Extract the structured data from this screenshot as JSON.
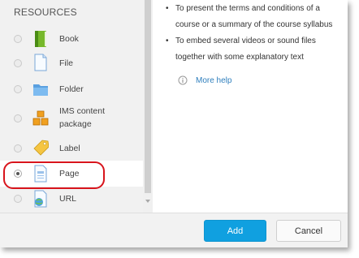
{
  "resources": {
    "title": "RESOURCES",
    "items": [
      {
        "label": "Book",
        "icon": "book-icon",
        "selected": false
      },
      {
        "label": "File",
        "icon": "file-icon",
        "selected": false
      },
      {
        "label": "Folder",
        "icon": "folder-icon",
        "selected": false
      },
      {
        "label": "IMS content package",
        "icon": "ims-package-icon",
        "selected": false
      },
      {
        "label": "Label",
        "icon": "label-tag-icon",
        "selected": false
      },
      {
        "label": "Page",
        "icon": "page-icon",
        "selected": true
      },
      {
        "label": "URL",
        "icon": "url-globe-icon",
        "selected": false
      }
    ]
  },
  "help": {
    "bullets": [
      "To present the terms and conditions of a course or a summary of the course syllabus",
      "To embed several videos or sound files together with some explanatory text"
    ],
    "more_help": "More help"
  },
  "footer": {
    "add_label": "Add",
    "cancel_label": "Cancel"
  },
  "colors": {
    "accent": "#10a0e0",
    "highlight": "#d8141c",
    "link": "#2f7fbd"
  }
}
